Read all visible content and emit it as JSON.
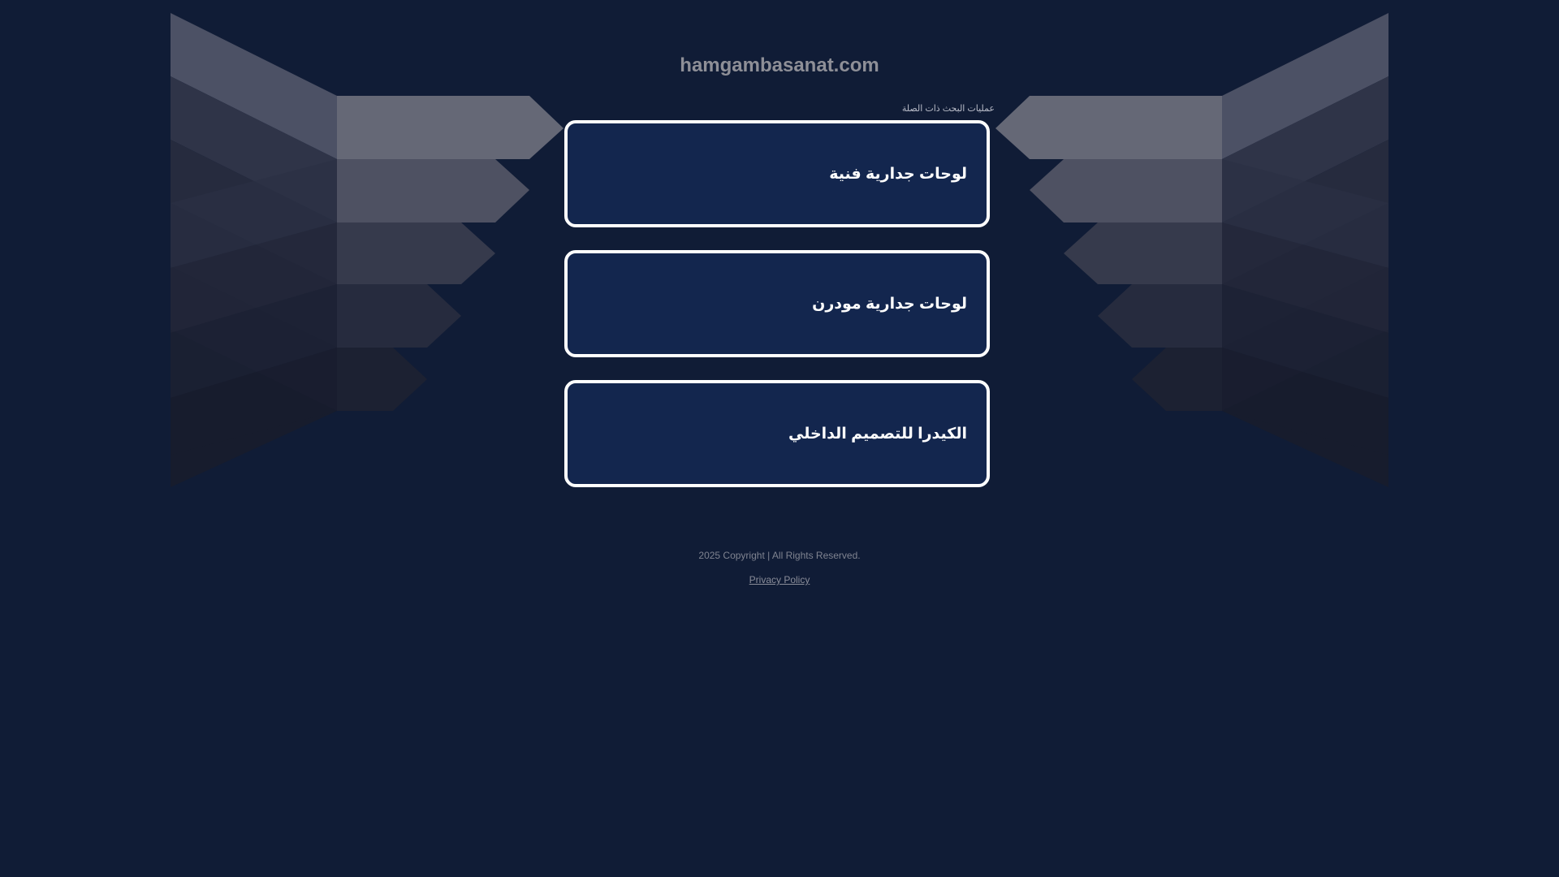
{
  "header": {
    "domain": "hamgambasanat.com"
  },
  "related_searches": {
    "label": "عمليات البحث ذات الصلة",
    "items": [
      {
        "label": "لوحات جدارية فنية"
      },
      {
        "label": "لوحات جدارية مودرن"
      },
      {
        "label": "الكيدرا للتصميم الداخلي"
      }
    ]
  },
  "footer": {
    "copyright": "2025 Copyright | All Rights Reserved.",
    "privacy_label": "Privacy Policy"
  },
  "colors": {
    "background": "#101c36",
    "box_fill": "#13264e",
    "box_border": "#ffffff"
  }
}
